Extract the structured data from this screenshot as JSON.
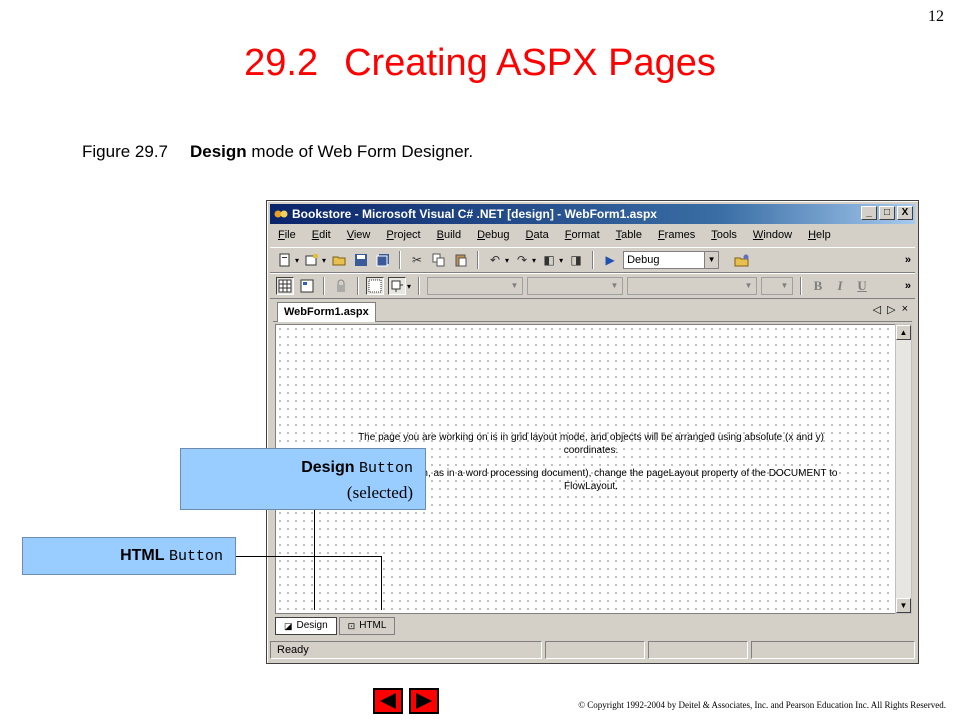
{
  "slide": {
    "page_number": "12",
    "title_number": "29.2",
    "title_text": "Creating ASPX Pages",
    "caption_number": "Figure 29.7",
    "caption_bold": "Design",
    "caption_rest": " mode of Web Form Designer.",
    "copyright": "© Copyright 1992-2004 by Deitel & Associates, Inc. and Pearson Education Inc. All Rights Reserved."
  },
  "window": {
    "title": "Bookstore - Microsoft Visual C# .NET [design] - WebForm1.aspx",
    "buttons": [
      "_",
      "□",
      "X"
    ],
    "menu": [
      "File",
      "Edit",
      "View",
      "Project",
      "Build",
      "Debug",
      "Data",
      "Format",
      "Table",
      "Frames",
      "Tools",
      "Window",
      "Help"
    ],
    "debug_config": "Debug",
    "format_buttons": [
      "B",
      "I",
      "U"
    ],
    "more_chevron": "»",
    "doc_tab": "WebForm1.aspx",
    "tab_controls": [
      "◁",
      "▷",
      "×"
    ],
    "grid_message_1": "The page you are working on is in grid layout mode, and objects will be arranged using absolute (x and y) coordinates.",
    "grid_message_2": "yout (top to bottom, as in a word processing document), change the pageLayout property of the DOCUMENT to FlowLayout.",
    "view_tabs": [
      "Design",
      "HTML"
    ],
    "status": "Ready"
  },
  "callouts": {
    "design_bold": "Design",
    "design_code": "Button",
    "design_sub": "(selected)",
    "html_bold": "HTML",
    "html_code": "Button"
  },
  "colors": {
    "title": "#ff0000",
    "callout_fill": "#99ccff",
    "titlebar_start": "#0a246a",
    "nav_arrow": "#ff0000"
  },
  "icons": [
    "app-icon",
    "new-project-icon",
    "add-item-icon",
    "open-icon",
    "save-icon",
    "save-all-icon",
    "cut-icon",
    "copy-icon",
    "paste-icon",
    "undo-icon",
    "redo-icon",
    "navigate-back-icon",
    "navigate-forward-icon",
    "start-icon",
    "solution-explorer-icon",
    "grid-icon",
    "lock-icon",
    "show-details-icon",
    "prev-arrow-icon",
    "next-arrow-icon"
  ]
}
